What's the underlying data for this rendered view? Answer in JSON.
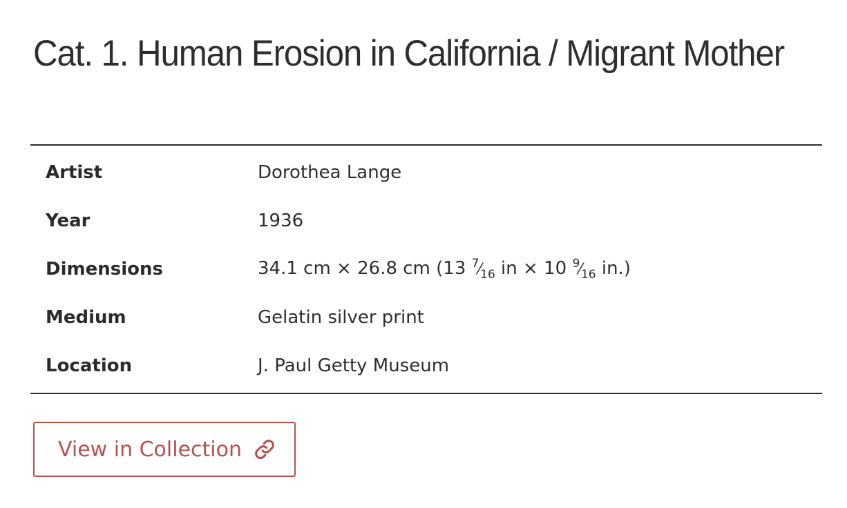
{
  "page": {
    "title": "Cat. 1. Human Erosion in California / Migrant Mother"
  },
  "details": [
    {
      "label": "Artist",
      "value": "Dorothea Lange"
    },
    {
      "label": "Year",
      "value": "1936"
    },
    {
      "label": "Dimensions",
      "value": "34.1 cm × 26.8 cm (13 ",
      "frac1_num": "7",
      "frac1_den": "16",
      "mid": " in × 10 ",
      "frac2_num": "9",
      "frac2_den": "16",
      "end": " in.)"
    },
    {
      "label": "Medium",
      "value": "Gelatin silver print"
    },
    {
      "label": "Location",
      "value": "J. Paul Getty Museum"
    }
  ],
  "actions": {
    "view_collection_label": "View in Collection",
    "view_collection_icon": "link-icon"
  },
  "colors": {
    "accent": "#b5524f",
    "text": "#2b2b2b"
  }
}
